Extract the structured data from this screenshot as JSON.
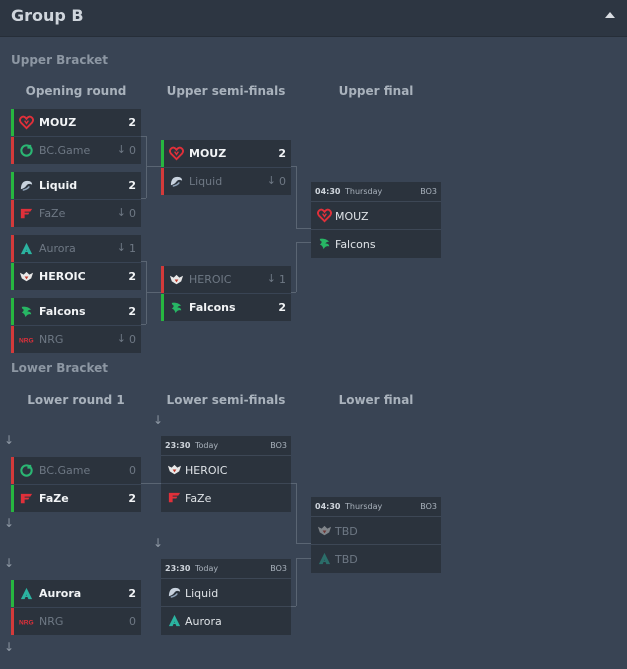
{
  "header": {
    "title": "Group B"
  },
  "upper": {
    "label": "Upper Bracket",
    "columns": [
      "Opening round",
      "Upper semi-finals",
      "Upper final"
    ]
  },
  "lower": {
    "label": "Lower Bracket",
    "columns": [
      "Lower round 1",
      "Lower semi-finals",
      "Lower final"
    ]
  },
  "rows": {
    "or1a": {
      "name": "MOUZ",
      "score": "2"
    },
    "or1b": {
      "name": "BC.Game",
      "score": "0"
    },
    "or2a": {
      "name": "Liquid",
      "score": "2"
    },
    "or2b": {
      "name": "FaZe",
      "score": "0"
    },
    "or3a": {
      "name": "Aurora",
      "score": "1"
    },
    "or3b": {
      "name": "HEROIC",
      "score": "2"
    },
    "or4a": {
      "name": "Falcons",
      "score": "2"
    },
    "or4b": {
      "name": "NRG",
      "score": "0"
    },
    "us1a": {
      "name": "MOUZ",
      "score": "2"
    },
    "us1b": {
      "name": "Liquid",
      "score": "0"
    },
    "us2a": {
      "name": "HEROIC",
      "score": "1"
    },
    "us2b": {
      "name": "Falcons",
      "score": "2"
    },
    "lr1a": {
      "name": "BC.Game",
      "score": "0"
    },
    "lr1b": {
      "name": "FaZe",
      "score": "2"
    },
    "lr2a": {
      "name": "Aurora",
      "score": "2"
    },
    "lr2b": {
      "name": "NRG",
      "score": "0"
    }
  },
  "matches": {
    "uf": {
      "time": "04:30",
      "day": "Thursday",
      "format": "BO3",
      "team1": "MOUZ",
      "team2": "Falcons"
    },
    "ls1": {
      "time": "23:30",
      "day": "Today",
      "format": "BO3",
      "team1": "HEROIC",
      "team2": "FaZe"
    },
    "ls2": {
      "time": "23:30",
      "day": "Today",
      "format": "BO3",
      "team1": "Liquid",
      "team2": "Aurora"
    },
    "lf": {
      "time": "04:30",
      "day": "Thursday",
      "format": "BO3",
      "team1": "TBD",
      "team2": "TBD"
    }
  },
  "arrow_glyph": "↓",
  "colors": {
    "win": "#27b640",
    "loss": "#d33a3a",
    "bg": "#394454",
    "card": "#2b333d"
  },
  "icons": {
    "MOUZ": "mouz-logo-icon",
    "BC.Game": "bcgame-logo-icon",
    "Liquid": "liquid-logo-icon",
    "FaZe": "faze-logo-icon",
    "Aurora": "aurora-logo-icon",
    "HEROIC": "heroic-logo-icon",
    "Falcons": "falcons-logo-icon",
    "NRG": "nrg-logo-icon"
  }
}
